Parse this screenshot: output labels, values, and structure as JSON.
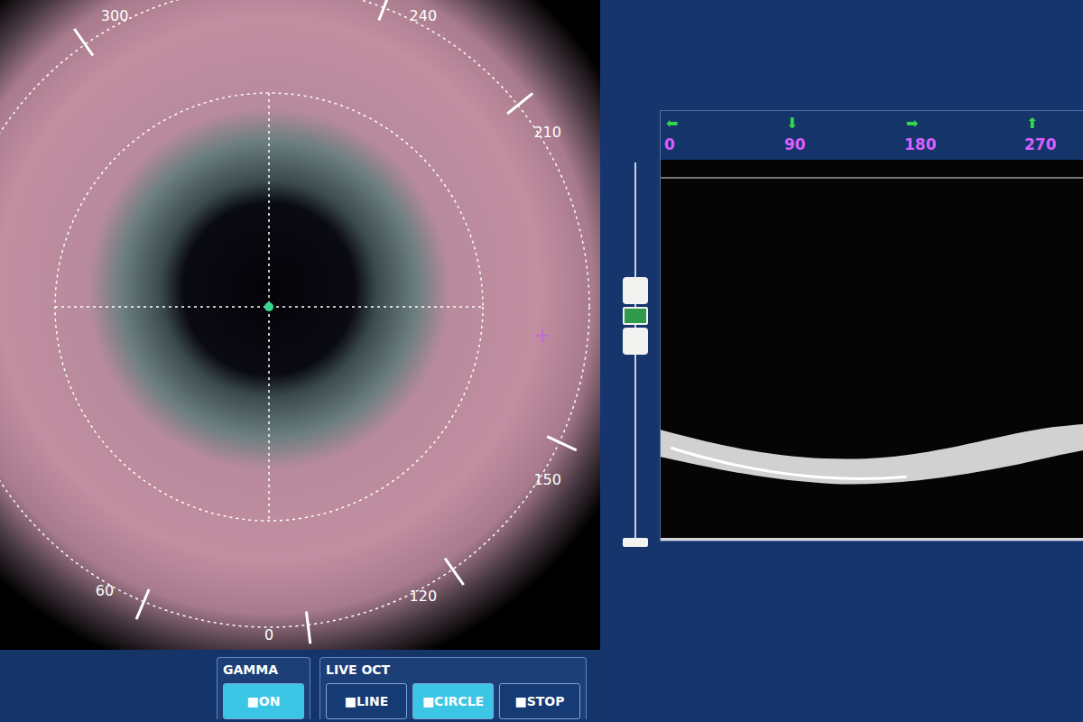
{
  "video_overlay": {
    "ring_labels": [
      "300",
      "240",
      "210",
      "150",
      "120",
      "0",
      "60"
    ]
  },
  "depth_slider": {
    "level": 0.62
  },
  "oct_panel": {
    "markers": [
      {
        "icon": "⬅",
        "label": "0"
      },
      {
        "icon": "⬇",
        "label": "90"
      },
      {
        "icon": "➡",
        "label": "180"
      },
      {
        "icon": "⬆",
        "label": "270"
      }
    ]
  },
  "controls": [
    {
      "title": "GAMMA",
      "buttons": [
        {
          "label": "■ON",
          "selected": true
        }
      ]
    },
    {
      "title": "LIVE OCT",
      "buttons": [
        {
          "label": "■LINE",
          "selected": false
        },
        {
          "label": "■CIRCLE",
          "selected": true
        },
        {
          "label": "■STOP",
          "selected": false
        }
      ]
    }
  ]
}
